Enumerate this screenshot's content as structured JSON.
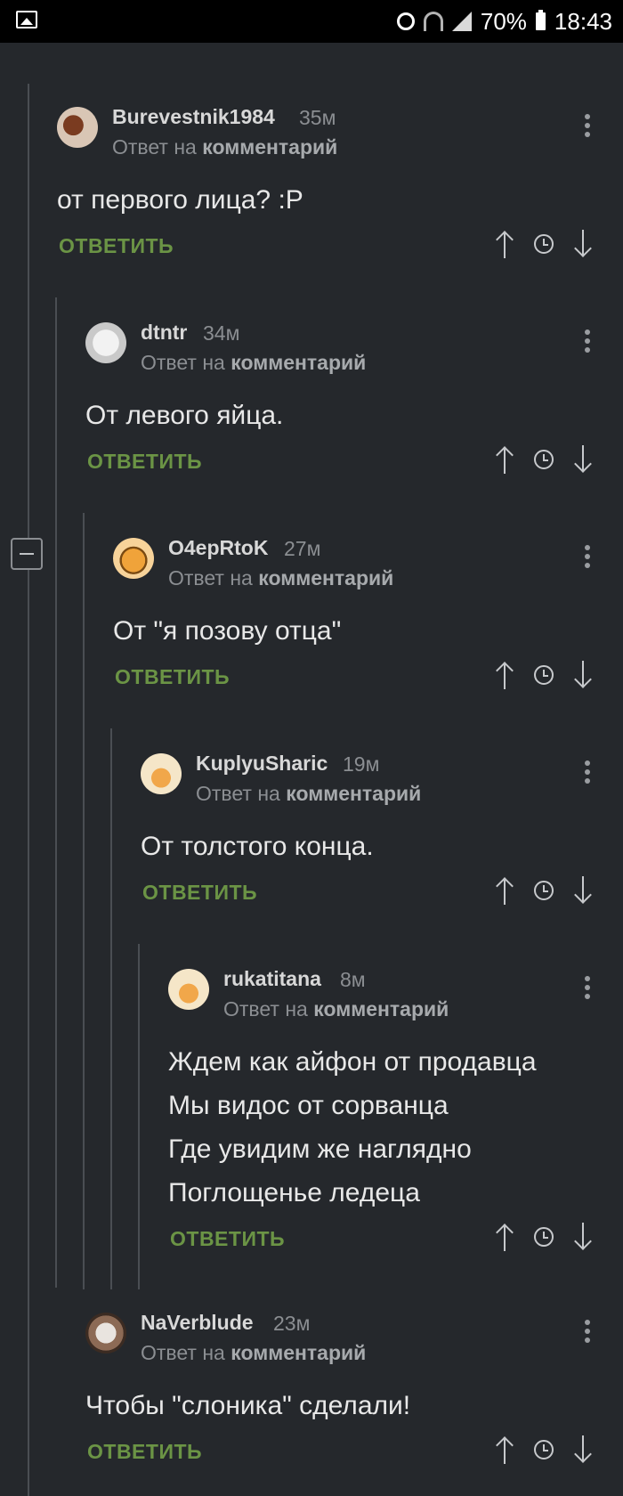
{
  "status_bar": {
    "battery": "70%",
    "time": "18:43"
  },
  "reply_to_prefix": "Ответ на",
  "reply_to_target": "комментарий",
  "reply_label": "ОТВЕТИТЬ",
  "comments": [
    {
      "author": "Burevestnik1984",
      "time": "35м",
      "body": [
        "от первого лица? :P"
      ]
    },
    {
      "author": "dtntr",
      "time": "34м",
      "body": [
        "От левого яйца."
      ]
    },
    {
      "author": "O4epRtoK",
      "time": "27м",
      "body": [
        "От \"я позову отца\""
      ]
    },
    {
      "author": "KuplyuSharic",
      "time": "19м",
      "body": [
        "От толстого конца."
      ]
    },
    {
      "author": "rukatitana",
      "time": "8м",
      "body": [
        "Ждем как айфон от продавца",
        "Мы видос от сорванца",
        "Где увидим же наглядно",
        "Поглощенье ледеца"
      ]
    },
    {
      "author": "NaVerblude",
      "time": "23м",
      "body": [
        "Чтобы \"слоника\" сделали!"
      ]
    }
  ]
}
